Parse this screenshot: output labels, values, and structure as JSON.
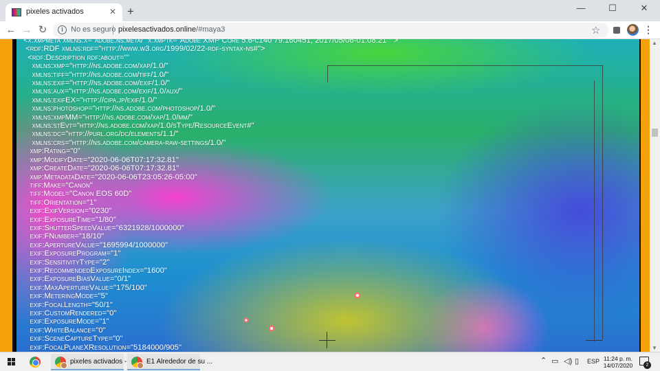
{
  "browser": {
    "tab": {
      "title": "pixeles activados",
      "close": "✕"
    },
    "new_tab": "+",
    "window_controls": {
      "minimize": "—",
      "maximize": "☐",
      "close": "✕"
    },
    "nav": {
      "back": "←",
      "forward": "→",
      "reload": "↻"
    },
    "omnibox": {
      "security_label": "No es seguro",
      "url_host": "pixelesactivados.online",
      "url_path": "/#maya3"
    },
    "icons": {
      "info": "info-icon",
      "star": "star-icon",
      "extensions": "puzzle-icon",
      "avatar": "profile-avatar",
      "menu": "kebab-menu-icon"
    },
    "star_glyph": "☆",
    "menu_glyph": "⋮"
  },
  "page": {
    "xmp_lines": [
      "<x:xmpmeta xmlns:x=\"adobe:ns:meta/\" x:xmptk=\"Adobe XMP Core 5.6-c140 79.160451, 2017/05/06-01:08:21  \">",
      " <rdf:RDF xmlns:rdf=\"http://www.w3.org/1999/02/22-rdf-syntax-ns#\">",
      "  <rdf:Description rdf:about=\"\"",
      "    xmlns:xmp=\"http://ns.adobe.com/xap/1.0/\"",
      "    xmlns:tiff=\"http://ns.adobe.com/tiff/1.0/\"",
      "    xmlns:exif=\"http://ns.adobe.com/exif/1.0/\"",
      "    xmlns:aux=\"http://ns.adobe.com/exif/1.0/aux/\"",
      "    xmlns:exifEX=\"http://cipa.jp/exif/1.0/\"",
      "    xmlns:photoshop=\"http://ns.adobe.com/photoshop/1.0/\"",
      "    xmlns:xmpMM=\"http://ns.adobe.com/xap/1.0/mm/\"",
      "    xmlns:stEvt=\"http://ns.adobe.com/xap/1.0/sType/ResourceEvent#\"",
      "    xmlns:dc=\"http://purl.org/dc/elements/1.1/\"",
      "    xmlns:crs=\"http://ns.adobe.com/camera-raw-settings/1.0/\"",
      "   xmp:Rating=\"0\"",
      "   xmp:ModifyDate=\"2020-06-06T07:17:32.81\"",
      "   xmp:CreateDate=\"2020-06-06T07:17:32.81\"",
      "   xmp:MetadataDate=\"2020-06-06T23:05:26-05:00\"",
      "   tiff:Make=\"Canon\"",
      "   tiff:Model=\"Canon EOS 60D\"",
      "   tiff:Orientation=\"1\"",
      "   exif:ExifVersion=\"0230\"",
      "   exif:ExposureTime=\"1/80\"",
      "   exif:ShutterSpeedValue=\"6321928/1000000\"",
      "   exif:FNumber=\"18/10\"",
      "   exif:ApertureValue=\"1695994/1000000\"",
      "   exif:ExposureProgram=\"1\"",
      "   exif:SensitivityType=\"2\"",
      "   exif:RecommendedExposureIndex=\"1600\"",
      "   exif:ExposureBiasValue=\"0/1\"",
      "   exif:MaxApertureValue=\"175/100\"",
      "   exif:MeteringMode=\"5\"",
      "   exif:FocalLength=\"50/1\"",
      "   exif:CustomRendered=\"0\"",
      "   exif:ExposureMode=\"1\"",
      "   exif:WhiteBalance=\"0\"",
      "   exif:SceneCaptureType=\"0\"",
      "   exif:FocalPlaneXResolution=\"5184000/905\""
    ],
    "colors": {
      "side_bars": "#f5a10b"
    }
  },
  "taskbar": {
    "start": "windows-start-icon",
    "pinned": "chrome-icon",
    "items": [
      {
        "label": "pixeles activados - ..."
      },
      {
        "label": "E1 Alrededor de su ..."
      }
    ],
    "tray": {
      "chevron": "⌃",
      "language": "ESP",
      "time": "11:24 p. m.",
      "date": "14/07/2020",
      "notifications_count": "2"
    }
  }
}
